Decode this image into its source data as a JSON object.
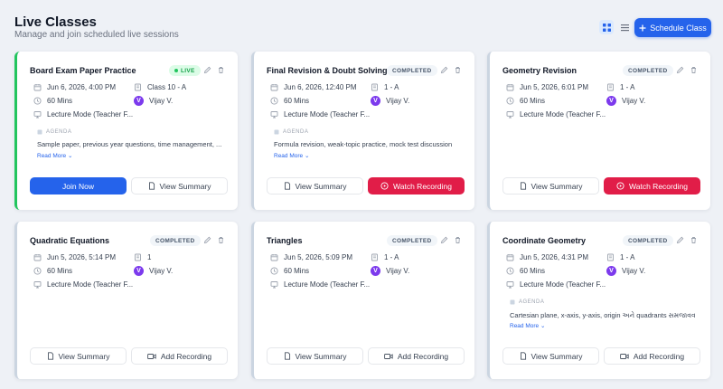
{
  "header": {
    "title": "Live Classes",
    "subtitle": "Manage and join scheduled live sessions",
    "schedule_label": "Schedule Class",
    "accent_color": "#2563eb"
  },
  "cards": [
    {
      "title": "Board Exam Paper Practice",
      "badge": "LIVE",
      "datetime": "Jun 6, 2026, 4:00 PM",
      "class": "Class 10 - A",
      "duration": "60 Mins",
      "teacher_initial": "V",
      "teacher": "Vijay V.",
      "mode": "Lecture Mode (Teacher F...",
      "agenda_label": "AGENDA",
      "agenda": "Sample paper, previous year questions, time management, ...",
      "read_more": "Read More",
      "btn1": "Join Now",
      "btn2": "View Summary"
    },
    {
      "title": "Final Revision & Doubt Solving",
      "badge": "COMPLETED",
      "datetime": "Jun 6, 2026, 12:40 PM",
      "class": "1 - A",
      "duration": "60 Mins",
      "teacher_initial": "V",
      "teacher": "Vijay V.",
      "mode": "Lecture Mode (Teacher F...",
      "agenda_label": "AGENDA",
      "agenda": "Formula revision, weak-topic practice, mock test discussion",
      "read_more": "Read More",
      "btn1": "View Summary",
      "btn2": "Watch Recording"
    },
    {
      "title": "Geometry Revision",
      "badge": "COMPLETED",
      "datetime": "Jun 5, 2026, 6:01 PM",
      "class": "1 - A",
      "duration": "60 Mins",
      "teacher_initial": "V",
      "teacher": "Vijay V.",
      "mode": "Lecture Mode (Teacher F...",
      "btn1": "View Summary",
      "btn2": "Watch Recording"
    },
    {
      "title": "Quadratic Equations",
      "badge": "COMPLETED",
      "datetime": "Jun 5, 2026, 5:14 PM",
      "class": "1",
      "duration": "60 Mins",
      "teacher_initial": "V",
      "teacher": "Vijay V.",
      "mode": "Lecture Mode (Teacher F...",
      "btn1": "View Summary",
      "btn2": "Add Recording"
    },
    {
      "title": "Triangles",
      "badge": "COMPLETED",
      "datetime": "Jun 5, 2026, 5:09 PM",
      "class": "1 - A",
      "duration": "60 Mins",
      "teacher_initial": "V",
      "teacher": "Vijay V.",
      "mode": "Lecture Mode (Teacher F...",
      "btn1": "View Summary",
      "btn2": "Add Recording"
    },
    {
      "title": "Coordinate Geometry",
      "badge": "COMPLETED",
      "datetime": "Jun 5, 2026, 4:31 PM",
      "class": "1 - A",
      "duration": "60 Mins",
      "teacher_initial": "V",
      "teacher": "Vijay V.",
      "mode": "Lecture Mode (Teacher F...",
      "agenda_label": "AGENDA",
      "agenda": "Cartesian plane, x-axis, y-axis, origin અને quadrants સમજાવવાં. ...",
      "read_more": "Read More",
      "btn1": "View Summary",
      "btn2": "Add Recording"
    }
  ]
}
